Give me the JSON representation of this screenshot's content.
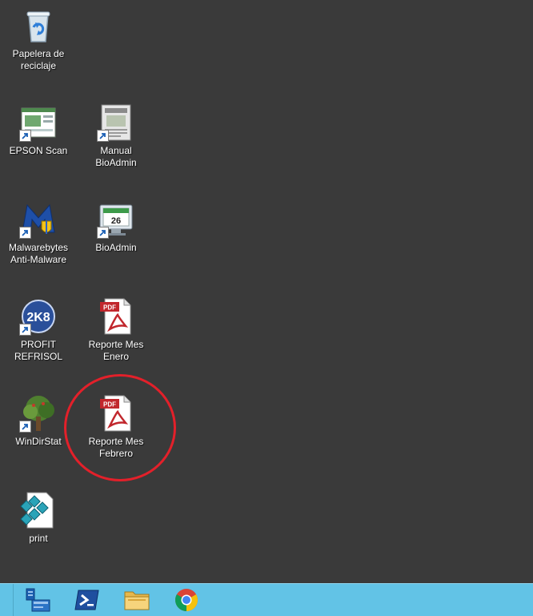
{
  "desktop": {
    "icons": [
      {
        "label": "Papelera de\nreciclaje",
        "icon": "recycle-bin-icon"
      },
      {
        "label": "EPSON Scan",
        "icon": "epson-scan-icon"
      },
      {
        "label": "Manual\nBioAdmin",
        "icon": "manual-document-icon"
      },
      {
        "label": "Malwarebytes\nAnti-Malware",
        "icon": "malwarebytes-icon"
      },
      {
        "label": "BioAdmin",
        "icon": "bioadmin-calendar-icon"
      },
      {
        "label": "PROFIT REFRISOL",
        "icon": "profit-2k8-icon"
      },
      {
        "label": "Reporte Mes\nEnero",
        "icon": "pdf-file-icon"
      },
      {
        "label": "WinDirStat",
        "icon": "windirstat-tree-icon"
      },
      {
        "label": "Reporte Mes\nFebrero",
        "icon": "pdf-file-icon"
      },
      {
        "label": "print",
        "icon": "print-script-icon"
      }
    ],
    "pdf_badge": "PDF",
    "calendar_day": "26",
    "profit_badge": "2K8"
  },
  "taskbar": {
    "items": [
      {
        "name": "server-manager",
        "icon": "server-manager-icon"
      },
      {
        "name": "powershell",
        "icon": "powershell-icon"
      },
      {
        "name": "file-explorer",
        "icon": "folder-icon"
      },
      {
        "name": "chrome",
        "icon": "chrome-icon"
      }
    ]
  },
  "colors": {
    "desktop_bg": "#3a3a3a",
    "taskbar_bg": "#62c3e6",
    "highlight": "#e3202a",
    "pdf_red": "#c1272d"
  }
}
